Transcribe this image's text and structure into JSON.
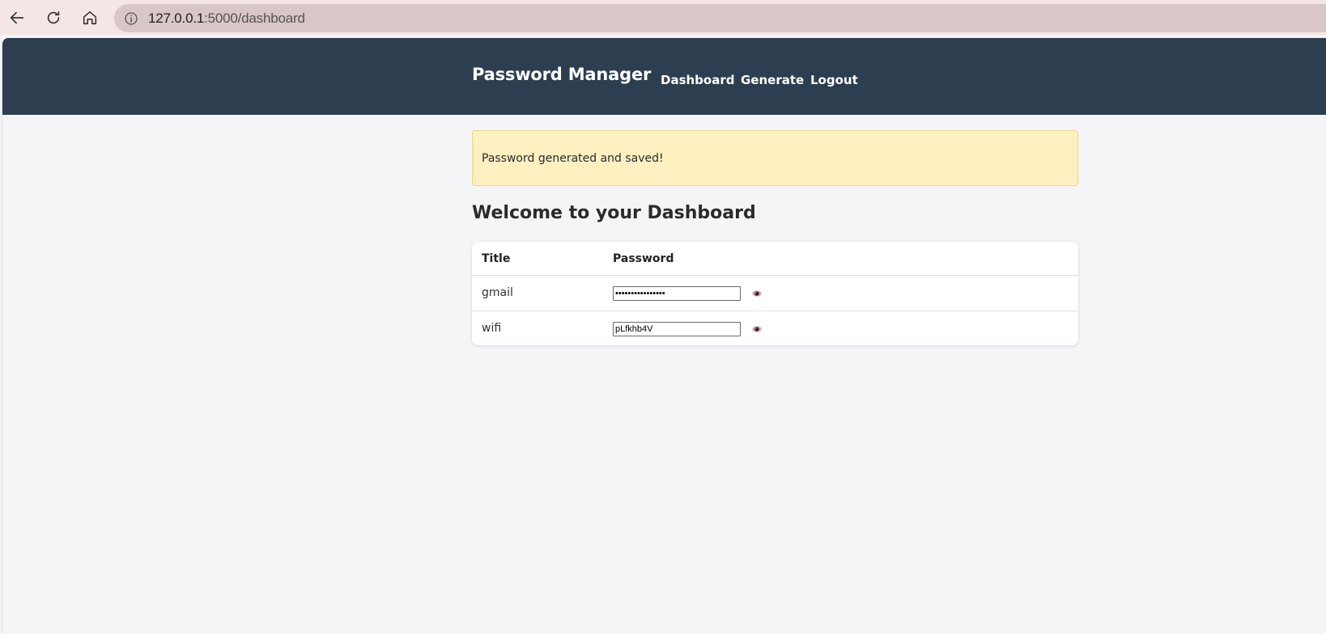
{
  "browser": {
    "url_host": "127.0.0.1",
    "url_path": ":5000/dashboard"
  },
  "navbar": {
    "brand": "Password Manager",
    "links": [
      "Dashboard",
      "Generate",
      "Logout"
    ]
  },
  "alert": {
    "message": "Password generated and saved!"
  },
  "main": {
    "title": "Welcome to your Dashboard",
    "table": {
      "headers": [
        "Title",
        "Password"
      ],
      "rows": [
        {
          "title": "gmail",
          "password": "••••••••••••••••"
        },
        {
          "title": "wifi",
          "password": "pLfkhb4V"
        }
      ]
    }
  },
  "colors": {
    "navbar_bg": "#2c3e50",
    "alert_bg": "#fff0c2",
    "page_bg": "#f4f5f7"
  },
  "icons": [
    "back-arrow-icon",
    "reload-icon",
    "home-icon",
    "info-icon",
    "eye-icon"
  ]
}
